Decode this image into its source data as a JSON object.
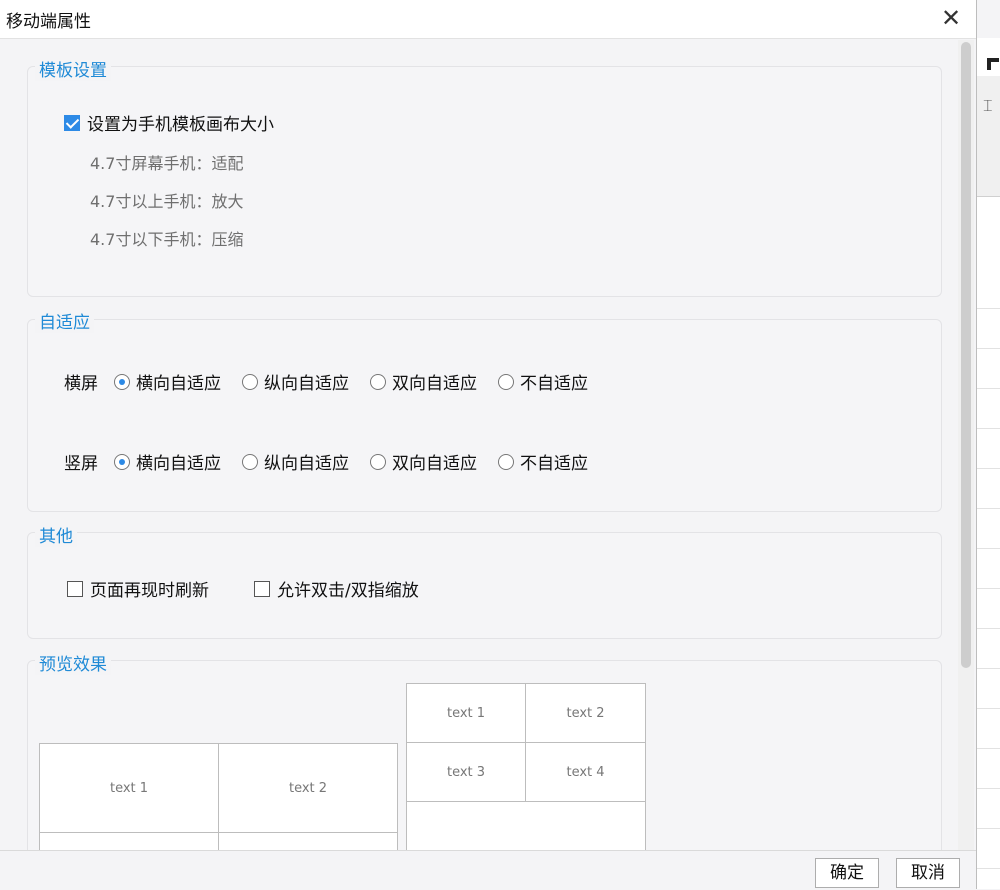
{
  "window": {
    "title": "移动端属性",
    "close_glyph": "✕"
  },
  "template_settings": {
    "group_title": "模板设置",
    "checkbox_label": "设置为手机模板画布大小",
    "checked": true,
    "info": [
      "4.7寸屏幕手机：适配",
      "4.7寸以上手机：放大",
      "4.7寸以下手机：压缩"
    ]
  },
  "adaptive": {
    "group_title": "自适应",
    "landscape": {
      "label": "横屏",
      "options": [
        "横向自适应",
        "纵向自适应",
        "双向自适应",
        "不自适应"
      ],
      "selected": "横向自适应"
    },
    "portrait": {
      "label": "竖屏",
      "options": [
        "横向自适应",
        "纵向自适应",
        "双向自适应",
        "不自适应"
      ],
      "selected": "横向自适应"
    }
  },
  "other": {
    "group_title": "其他",
    "options": [
      {
        "label": "页面再现时刷新",
        "checked": false
      },
      {
        "label": "允许双击/双指缩放",
        "checked": false
      }
    ]
  },
  "preview": {
    "group_title": "预览效果",
    "left_table": [
      "text 1",
      "text 2"
    ],
    "right_table": [
      "text 1",
      "text 2",
      "text 3",
      "text 4"
    ]
  },
  "buttons": {
    "ok": "确定",
    "cancel": "取消"
  },
  "colors": {
    "accent": "#1f8ad6",
    "check": "#2d8ae6"
  }
}
